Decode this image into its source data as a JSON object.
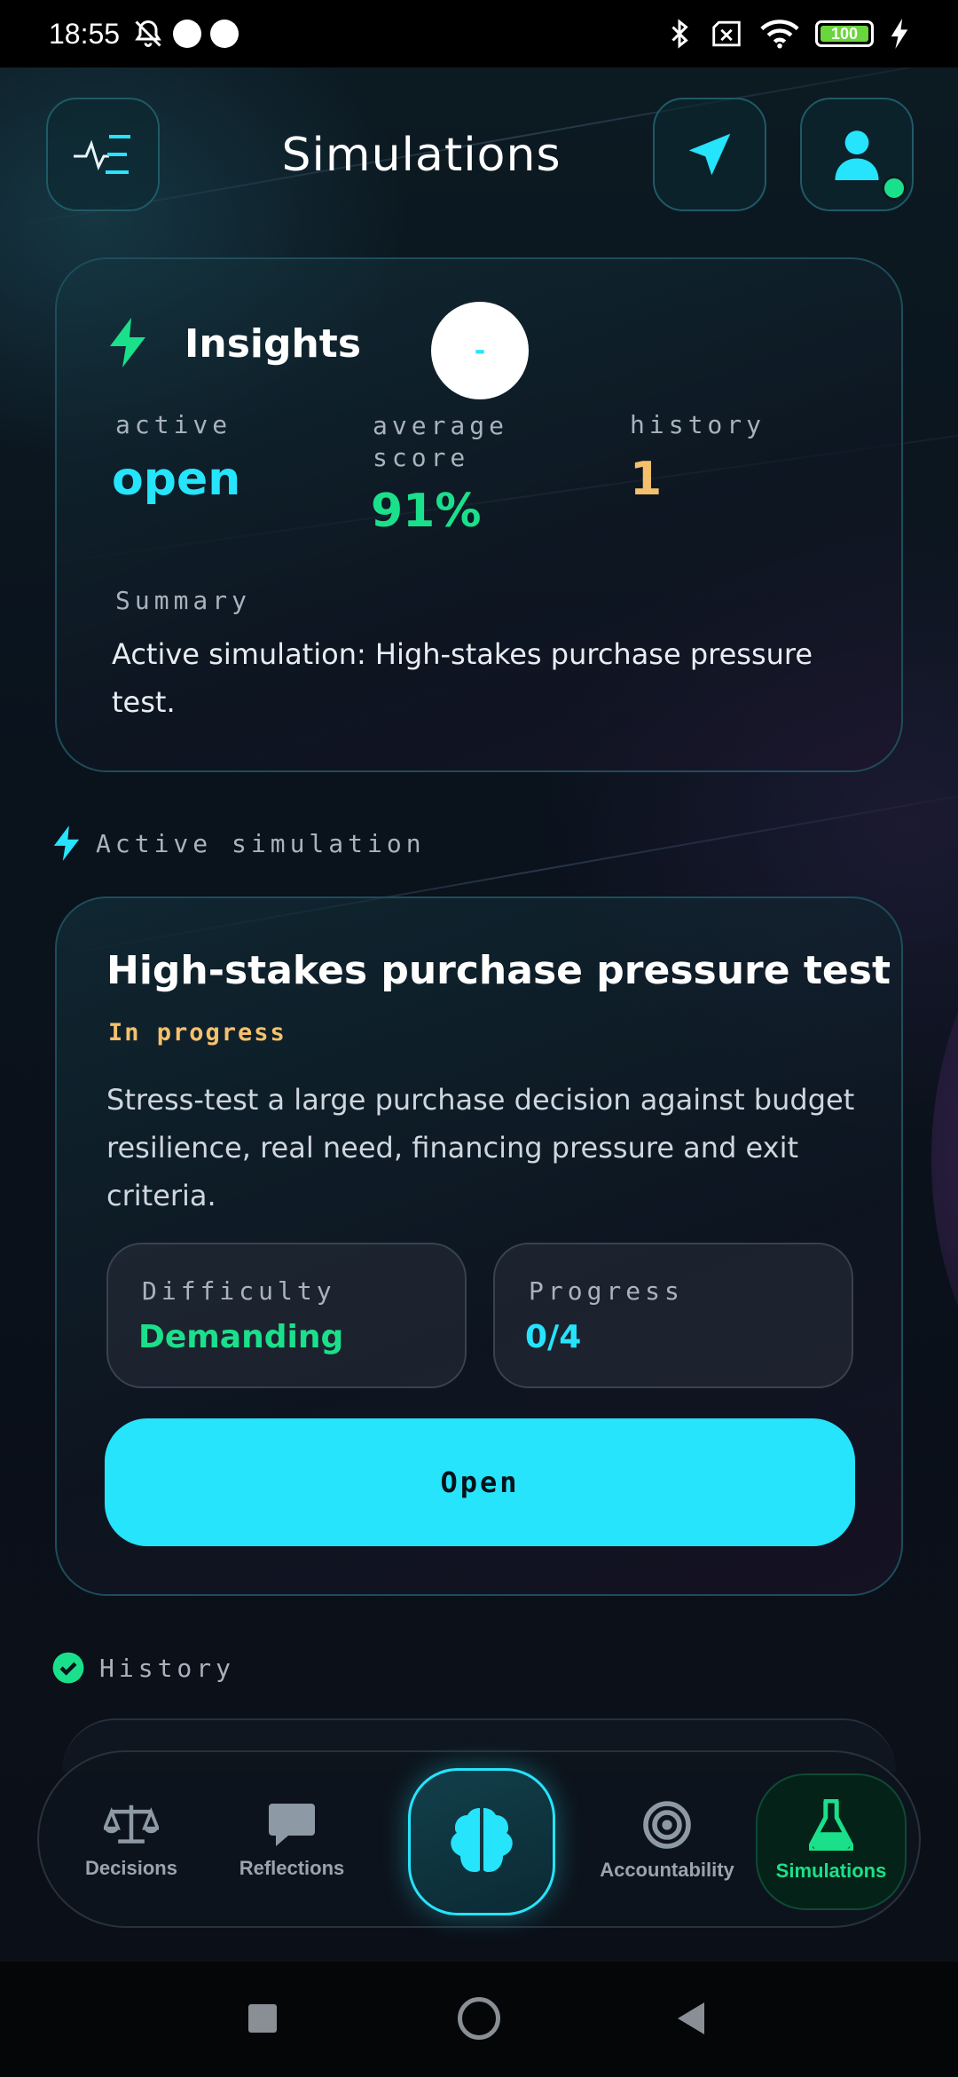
{
  "status_bar": {
    "time": "18:55",
    "battery": "100"
  },
  "header": {
    "title": "Simulations"
  },
  "insights": {
    "title": "Insights",
    "avatar_text": "-",
    "stats": [
      {
        "label": "active",
        "value": "open"
      },
      {
        "label": "average score",
        "value": "91%"
      },
      {
        "label": "history",
        "value": "1"
      }
    ],
    "summary_label": "Summary",
    "summary_text": "Active simulation: High-stakes purchase pressure test."
  },
  "active_section": {
    "label": "Active simulation"
  },
  "simulation": {
    "title": "High-stakes purchase pressure test",
    "status": "In progress",
    "description": "Stress-test a large purchase decision against budget resilience, real need, financing pressure and exit criteria.",
    "difficulty_label": "Difficulty",
    "difficulty_value": "Demanding",
    "progress_label": "Progress",
    "progress_value": "0/4",
    "open_label": "Open"
  },
  "history_section": {
    "label": "History"
  },
  "bottom_nav": [
    {
      "label": "Decisions",
      "icon": "scale-icon"
    },
    {
      "label": "Reflections",
      "icon": "chat-bubble-icon"
    },
    {
      "label": "",
      "icon": "brain-icon"
    },
    {
      "label": "Accountability",
      "icon": "target-icon"
    },
    {
      "label": "Simulations",
      "icon": "flask-icon"
    }
  ],
  "colors": {
    "accent_cyan": "#25e4fc",
    "accent_green": "#1be08b",
    "accent_orange": "#f5c16c"
  }
}
